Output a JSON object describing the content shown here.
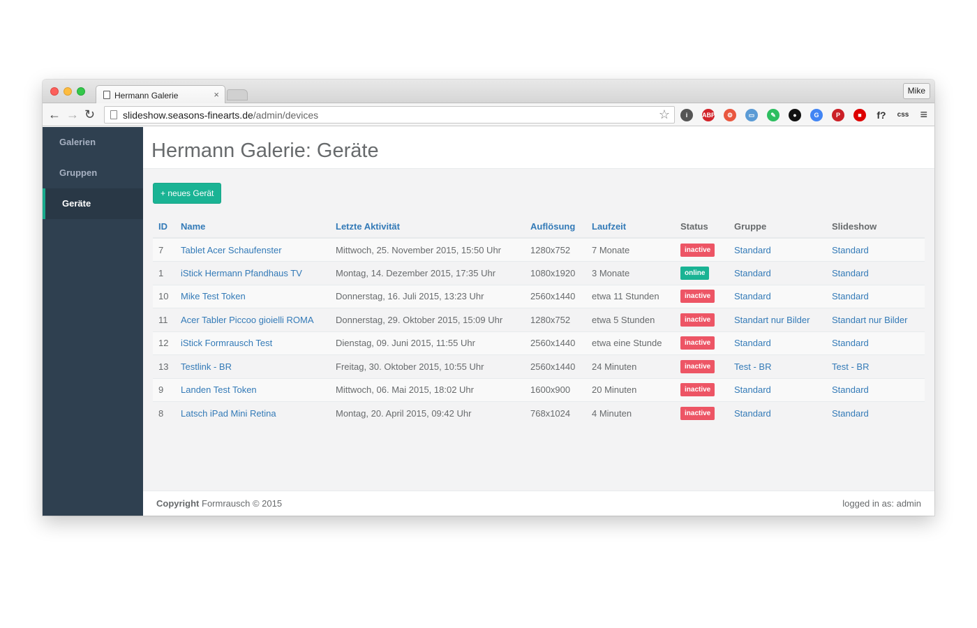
{
  "browser": {
    "tab_title": "Hermann Galerie",
    "tab_close": "×",
    "profile": "Mike",
    "url_host": "slideshow.seasons-finearts.de",
    "url_path": "/admin/devices",
    "back": "←",
    "forward": "→",
    "reload": "↻",
    "star": "☆",
    "menu": "≡",
    "extensions": [
      "info-icon",
      "adblock-icon",
      "extension-icon",
      "folder-icon",
      "evernote-icon",
      "camera-icon",
      "translate-icon",
      "pinterest-icon",
      "flag-de-icon",
      "font-icon",
      "css-icon"
    ]
  },
  "sidebar": {
    "items": [
      {
        "label": "Galerien"
      },
      {
        "label": "Gruppen"
      },
      {
        "label": "Geräte"
      }
    ]
  },
  "page": {
    "title": "Hermann Galerie: Geräte",
    "new_button": "+ neues Gerät"
  },
  "table": {
    "headers": [
      "ID",
      "Name",
      "Letzte Aktivität",
      "Auflösung",
      "Laufzeit",
      "Status",
      "Gruppe",
      "Slideshow"
    ],
    "rows": [
      {
        "id": "7",
        "name": "Tablet Acer Schaufenster",
        "activity": "Mittwoch, 25. November 2015, 15:50 Uhr",
        "resolution": "1280x752",
        "runtime": "7 Monate",
        "status": "inactive",
        "group": "Standard",
        "slideshow": "Standard"
      },
      {
        "id": "1",
        "name": "iStick Hermann Pfandhaus TV",
        "activity": "Montag, 14. Dezember 2015, 17:35 Uhr",
        "resolution": "1080x1920",
        "runtime": "3 Monate",
        "status": "online",
        "group": "Standard",
        "slideshow": "Standard"
      },
      {
        "id": "10",
        "name": "Mike Test Token",
        "activity": "Donnerstag, 16. Juli 2015, 13:23 Uhr",
        "resolution": "2560x1440",
        "runtime": "etwa 11 Stunden",
        "status": "inactive",
        "group": "Standard",
        "slideshow": "Standard"
      },
      {
        "id": "11",
        "name": "Acer Tabler Piccoo gioielli ROMA",
        "activity": "Donnerstag, 29. Oktober 2015, 15:09 Uhr",
        "resolution": "1280x752",
        "runtime": "etwa 5 Stunden",
        "status": "inactive",
        "group": "Standart nur Bilder",
        "slideshow": "Standart nur Bilder"
      },
      {
        "id": "12",
        "name": "iStick Formrausch Test",
        "activity": "Dienstag, 09. Juni 2015, 11:55 Uhr",
        "resolution": "2560x1440",
        "runtime": "etwa eine Stunde",
        "status": "inactive",
        "group": "Standard",
        "slideshow": "Standard"
      },
      {
        "id": "13",
        "name": "Testlink - BR",
        "activity": "Freitag, 30. Oktober 2015, 10:55 Uhr",
        "resolution": "2560x1440",
        "runtime": "24 Minuten",
        "status": "inactive",
        "group": "Test - BR",
        "slideshow": "Test - BR"
      },
      {
        "id": "9",
        "name": "Landen Test Token",
        "activity": "Mittwoch, 06. Mai 2015, 18:02 Uhr",
        "resolution": "1600x900",
        "runtime": "20 Minuten",
        "status": "inactive",
        "group": "Standard",
        "slideshow": "Standard"
      },
      {
        "id": "8",
        "name": "Latsch iPad Mini Retina",
        "activity": "Montag, 20. April 2015, 09:42 Uhr",
        "resolution": "768x1024",
        "runtime": "4 Minuten",
        "status": "inactive",
        "group": "Standard",
        "slideshow": "Standard"
      }
    ]
  },
  "status_colors": {
    "inactive": "#ed5565",
    "online": "#1ab394"
  },
  "footer": {
    "copyright_label": "Copyright",
    "copyright_text": " Formrausch © 2015",
    "logged_in": "logged in as: admin"
  }
}
